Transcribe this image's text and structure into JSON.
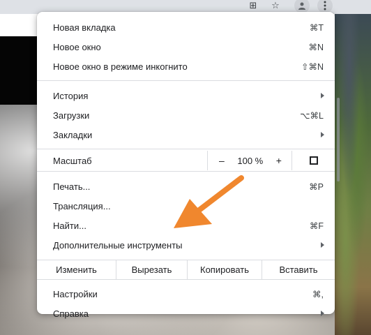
{
  "toolbar": {
    "icons": [
      "grid-icon",
      "star-icon",
      "profile-icon",
      "more-menu-icon"
    ]
  },
  "menu": {
    "group1": [
      {
        "label": "Новая вкладка",
        "shortcut": "⌘T"
      },
      {
        "label": "Новое окно",
        "shortcut": "⌘N"
      },
      {
        "label": "Новое окно в режиме инкогнито",
        "shortcut": "⇧⌘N"
      }
    ],
    "group2": [
      {
        "label": "История",
        "submenu": true
      },
      {
        "label": "Загрузки",
        "shortcut": "⌥⌘L"
      },
      {
        "label": "Закладки",
        "submenu": true
      }
    ],
    "zoom": {
      "label": "Масштаб",
      "minus": "–",
      "value": "100 %",
      "plus": "+"
    },
    "group3": [
      {
        "label": "Печать...",
        "shortcut": "⌘P"
      },
      {
        "label": "Трансляция..."
      },
      {
        "label": "Найти...",
        "shortcut": "⌘F"
      },
      {
        "label": "Дополнительные инструменты",
        "submenu": true
      }
    ],
    "edit": {
      "change": "Изменить",
      "cut": "Вырезать",
      "copy": "Копировать",
      "paste": "Вставить"
    },
    "group4": [
      {
        "label": "Настройки",
        "shortcut": "⌘,"
      },
      {
        "label": "Справка",
        "submenu": true
      }
    ]
  },
  "colors": {
    "annotation_arrow": "#f0872e",
    "menu_background": "#ffffff",
    "separator": "#dadce0"
  }
}
